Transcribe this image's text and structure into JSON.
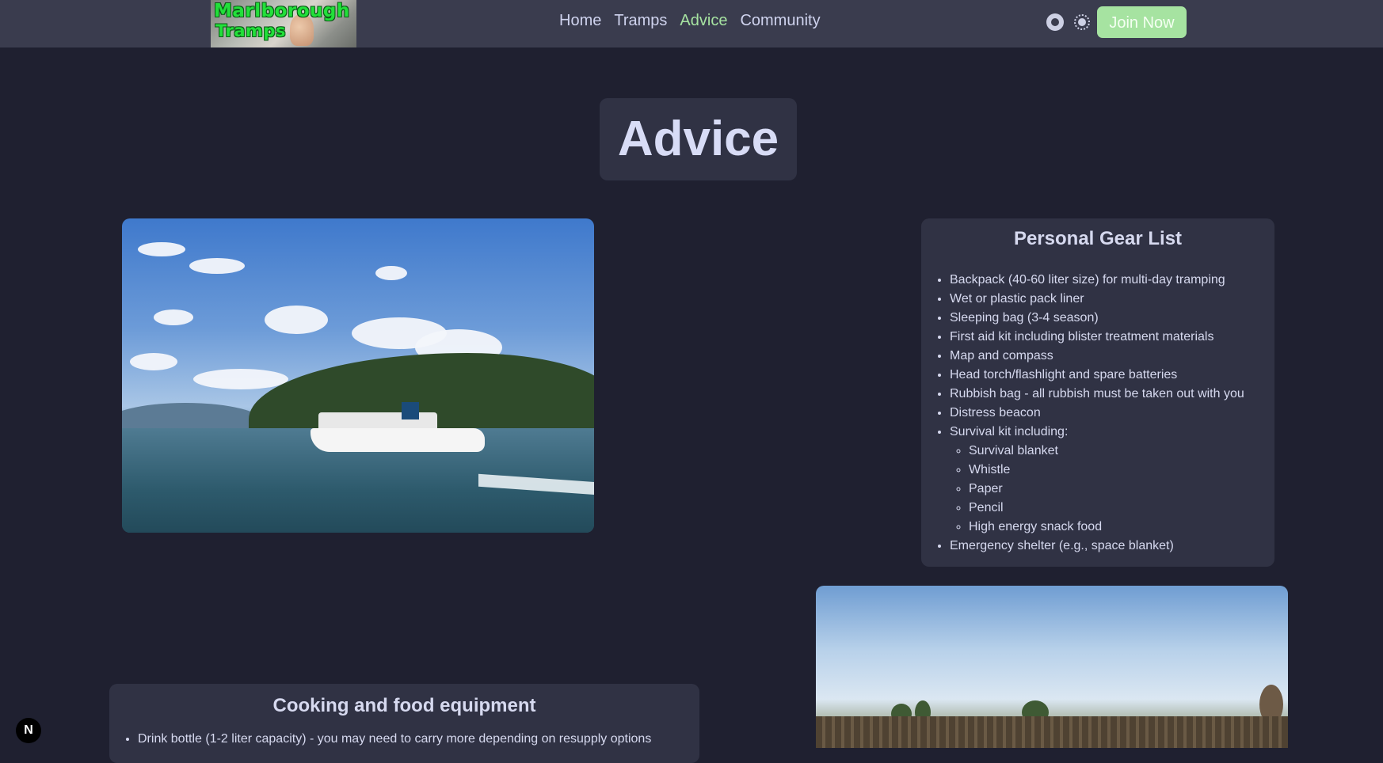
{
  "header": {
    "logo": {
      "line1": "Marlborough",
      "line2": "Tramps"
    },
    "nav": [
      {
        "label": "Home"
      },
      {
        "label": "Tramps"
      },
      {
        "label": "Advice",
        "active": true
      },
      {
        "label": "Community"
      }
    ],
    "icons": [
      "github-icon",
      "sun-icon"
    ],
    "join_label": "Join Now"
  },
  "page": {
    "title": "Advice"
  },
  "gear": {
    "title": "Personal Gear List",
    "items": [
      "Backpack (40-60 liter size) for multi-day tramping",
      "Wet or plastic pack liner",
      "Sleeping bag (3-4 season)",
      "First aid kit including blister treatment materials",
      "Map and compass",
      "Head torch/flashlight and spare batteries",
      "Rubbish bag - all rubbish must be taken out with you",
      "Distress beacon",
      "Survival kit including:"
    ],
    "survival_subitems": [
      "Survival blanket",
      "Whistle",
      "Paper",
      "Pencil",
      "High energy snack food"
    ],
    "last_item": "Emergency shelter (e.g., space blanket)"
  },
  "cooking": {
    "title": "Cooking and food equipment",
    "items": [
      "Drink bottle (1-2 liter capacity) - you may need to carry more depending on resupply options"
    ]
  },
  "next_badge": "N",
  "colors": {
    "background": "#1f2030",
    "header": "#3a3c4e",
    "card": "#303244",
    "accent": "#a6e3a1",
    "text": "#d6d9ef"
  }
}
